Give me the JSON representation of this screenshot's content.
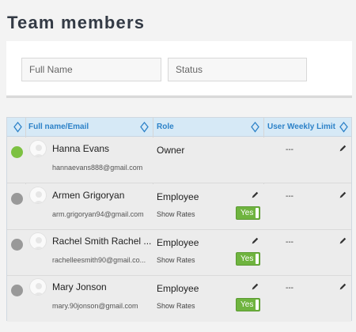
{
  "page": {
    "title": "Team members"
  },
  "filters": {
    "full_name_placeholder": "Full Name",
    "status_placeholder": "Status"
  },
  "table": {
    "headers": {
      "name": "Full name/Email",
      "role": "Role",
      "limit": "User Weekly Limit"
    },
    "rows": [
      {
        "name": "Hanna Evans",
        "email": "hannaevans888@gmail.com",
        "role": "Owner",
        "show_rates_label": "",
        "toggle_label": "",
        "limit": "---",
        "status": "active",
        "status_color": "#7dc142"
      },
      {
        "name": "Armen Grigoryan",
        "email": "arm.grigoryan94@gmail.com",
        "role": "Employee",
        "show_rates_label": "Show Rates",
        "toggle_label": "Yes",
        "limit": "---",
        "status": "inactive",
        "status_color": "#999999"
      },
      {
        "name": "Rachel Smith Rachel ...",
        "email": "rachelleesmith90@gmail.co...",
        "role": "Employee",
        "show_rates_label": "Show Rates",
        "toggle_label": "Yes",
        "limit": "---",
        "status": "inactive",
        "status_color": "#999999"
      },
      {
        "name": "Mary Jonson",
        "email": "mary.90jonson@gmail.com",
        "role": "Employee",
        "show_rates_label": "Show Rates",
        "toggle_label": "Yes",
        "limit": "---",
        "status": "inactive",
        "status_color": "#999999"
      }
    ]
  },
  "colors": {
    "accent": "#2d82c8",
    "header_bg": "#d6e9f6",
    "toggle_on": "#6fb43f"
  }
}
